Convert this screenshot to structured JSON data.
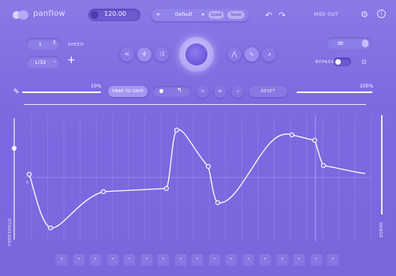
{
  "app": {
    "name": "panflow"
  },
  "header": {
    "bpm": "120.00",
    "preset": {
      "name": "Default",
      "load_label": "Load",
      "save_label": "Save"
    },
    "midi_out_label": "MIDI OUT",
    "info_label": "i"
  },
  "controls": {
    "rate": "1",
    "division": "1/32",
    "speed_label": "SPEED",
    "bypass_label": "BYPASS",
    "bypass_on": true
  },
  "range": {
    "min_pct": "10%",
    "max_pct": "100%",
    "snap_label": "SNAP TO GRID",
    "reset_label": "RESET"
  },
  "graph": {
    "threshold_label": "THRESHOLD",
    "range_label": "RANGE",
    "min_tick": "0"
  },
  "steps": {
    "count": 17
  },
  "colors": {
    "background": "#7f6be0",
    "accent": "#ffffff",
    "panel": "#8d7ee8"
  },
  "icons": {
    "undo": "undo-icon",
    "redo": "redo-icon",
    "settings": "gear-icon",
    "info": "info-icon",
    "loop": "infinity-icon"
  }
}
